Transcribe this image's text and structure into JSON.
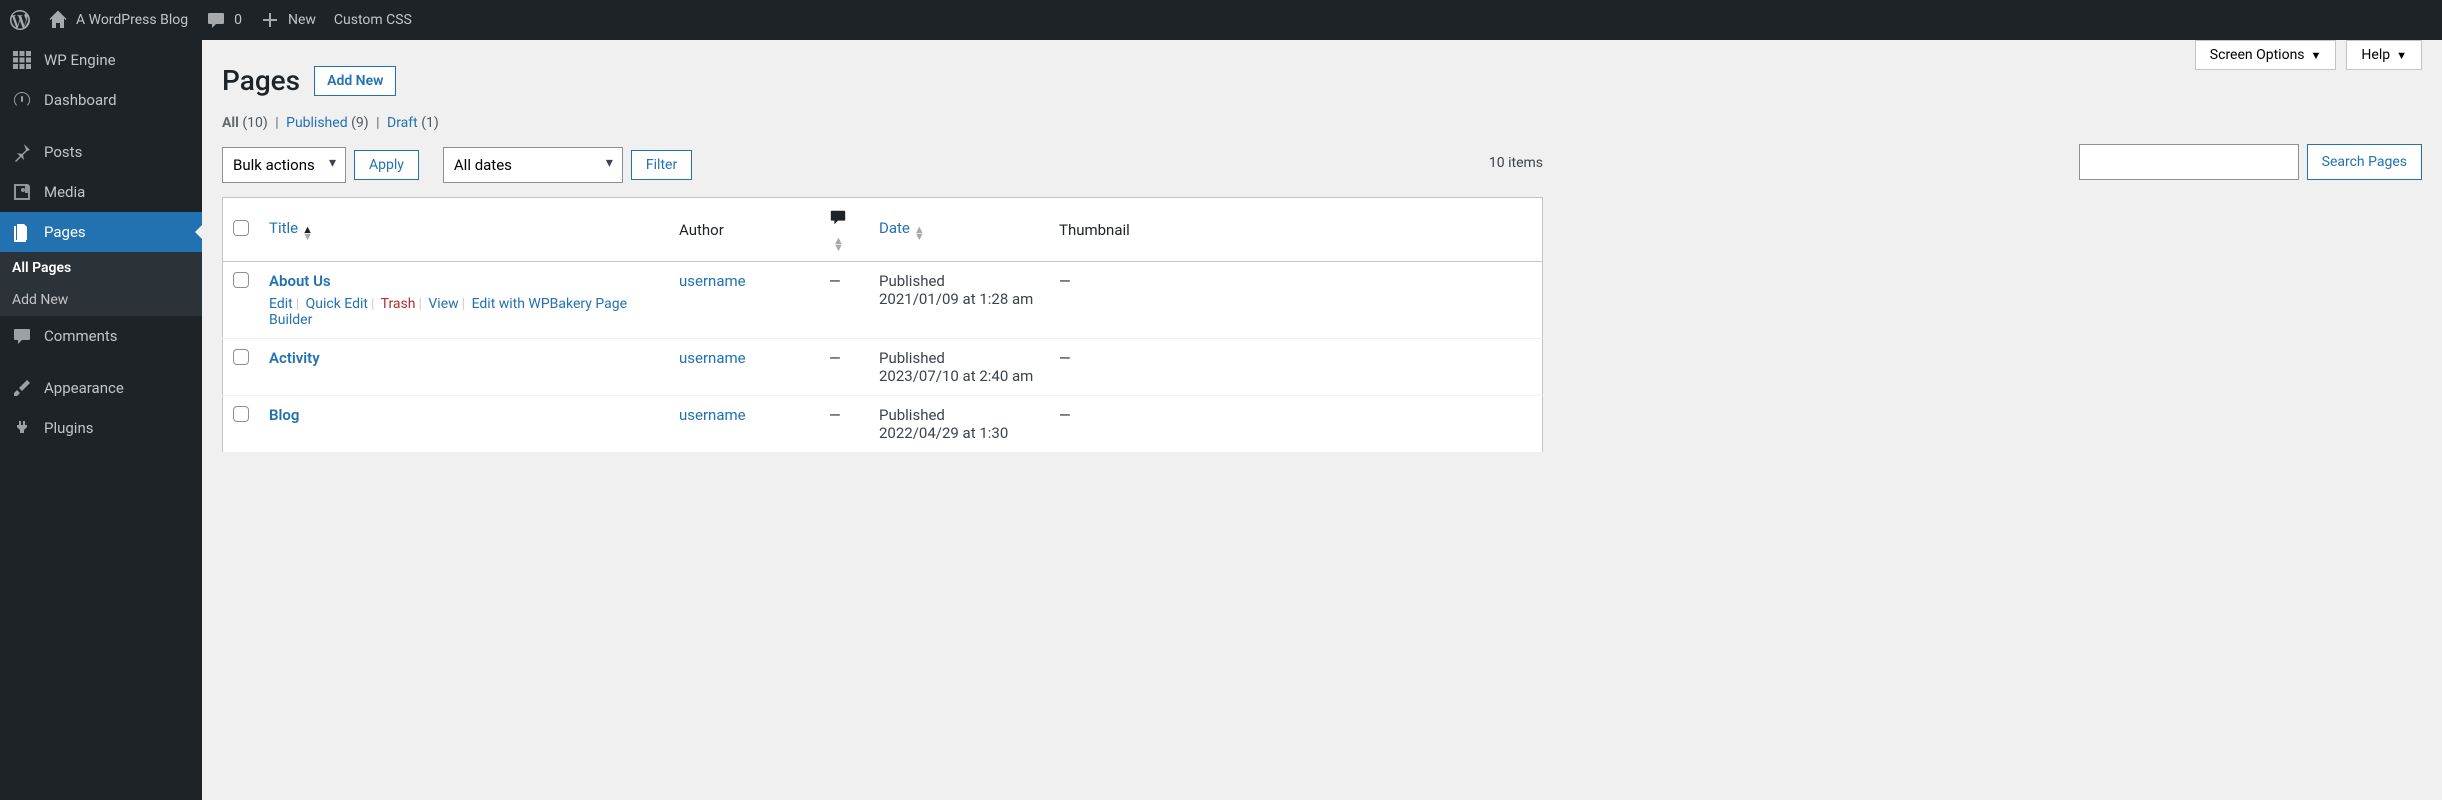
{
  "adminbar": {
    "site_title": "A WordPress Blog",
    "comment_count": "0",
    "new_label": "New",
    "custom_css_label": "Custom CSS"
  },
  "sidebar": {
    "items": [
      {
        "label": "WP Engine",
        "icon": "wpengine"
      },
      {
        "label": "Dashboard",
        "icon": "dashboard"
      },
      {
        "label": "Posts",
        "icon": "pin"
      },
      {
        "label": "Media",
        "icon": "media"
      },
      {
        "label": "Pages",
        "icon": "pages",
        "current": true
      },
      {
        "label": "Comments",
        "icon": "comment"
      },
      {
        "label": "Appearance",
        "icon": "brush"
      },
      {
        "label": "Plugins",
        "icon": "plug"
      }
    ],
    "submenu": [
      {
        "label": "All Pages",
        "current": true
      },
      {
        "label": "Add New"
      }
    ]
  },
  "topbuttons": {
    "screen_options": "Screen Options",
    "help": "Help"
  },
  "page": {
    "title": "Pages",
    "add_new": "Add New"
  },
  "filters": {
    "all_label": "All",
    "all_count": "(10)",
    "published_label": "Published",
    "published_count": "(9)",
    "draft_label": "Draft",
    "draft_count": "(1)"
  },
  "search": {
    "button": "Search Pages"
  },
  "bulk": {
    "label": "Bulk actions",
    "apply": "Apply",
    "dates": "All dates",
    "filter": "Filter",
    "items_count": "10 items"
  },
  "columns": {
    "title": "Title",
    "author": "Author",
    "date": "Date",
    "thumbnail": "Thumbnail"
  },
  "row_actions": {
    "edit": "Edit",
    "quick_edit": "Quick Edit",
    "trash": "Trash",
    "view": "View",
    "builder": "Edit with WPBakery Page Builder"
  },
  "rows": [
    {
      "title": "About Us",
      "author": "username",
      "comments": "—",
      "status": "Published",
      "date": "2021/01/09 at 1:28 am",
      "thumb": "—",
      "show_actions": true
    },
    {
      "title": "Activity",
      "author": "username",
      "comments": "—",
      "status": "Published",
      "date": "2023/07/10 at 2:40 am",
      "thumb": "—"
    },
    {
      "title": "Blog",
      "author": "username",
      "comments": "—",
      "status": "Published",
      "date": "2022/04/29 at 1:30",
      "thumb": "—"
    }
  ]
}
